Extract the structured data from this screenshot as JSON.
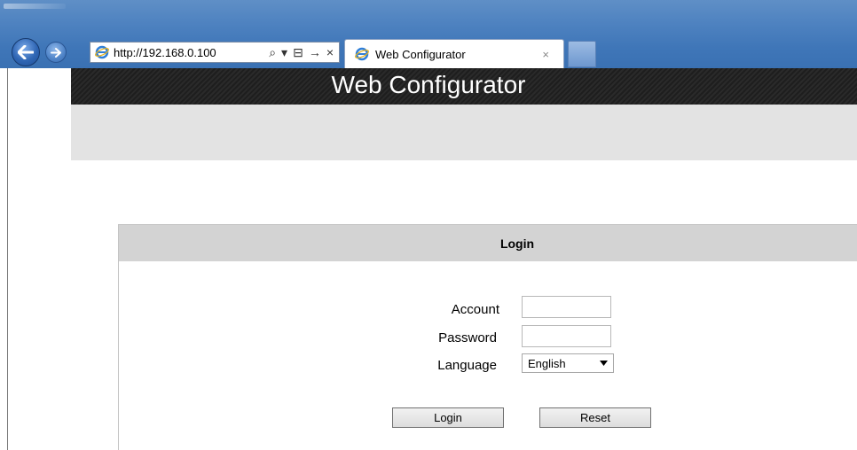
{
  "browser": {
    "address_url": "http://192.168.0.100",
    "address_tools": {
      "search": "⌕",
      "dropdown": "▾",
      "compat": "⊟",
      "go": "→",
      "stop": "×"
    },
    "tab_title": "Web Configurator",
    "tab_close": "×",
    "back_glyph": "←",
    "forward_glyph": "→"
  },
  "header": {
    "title": "Web Configurator"
  },
  "login": {
    "panel_title": "Login",
    "account_label": "Account",
    "account_value": "",
    "password_label": "Password",
    "password_value": "",
    "language_label": "Language",
    "language_selected": "English",
    "login_button": "Login",
    "reset_button": "Reset"
  },
  "colors": {
    "chrome_blue": "#4e82c0",
    "banner_bg": "#1e1e1e",
    "subbar_bg": "#e3e3e3",
    "panel_header_bg": "#d3d3d3"
  }
}
